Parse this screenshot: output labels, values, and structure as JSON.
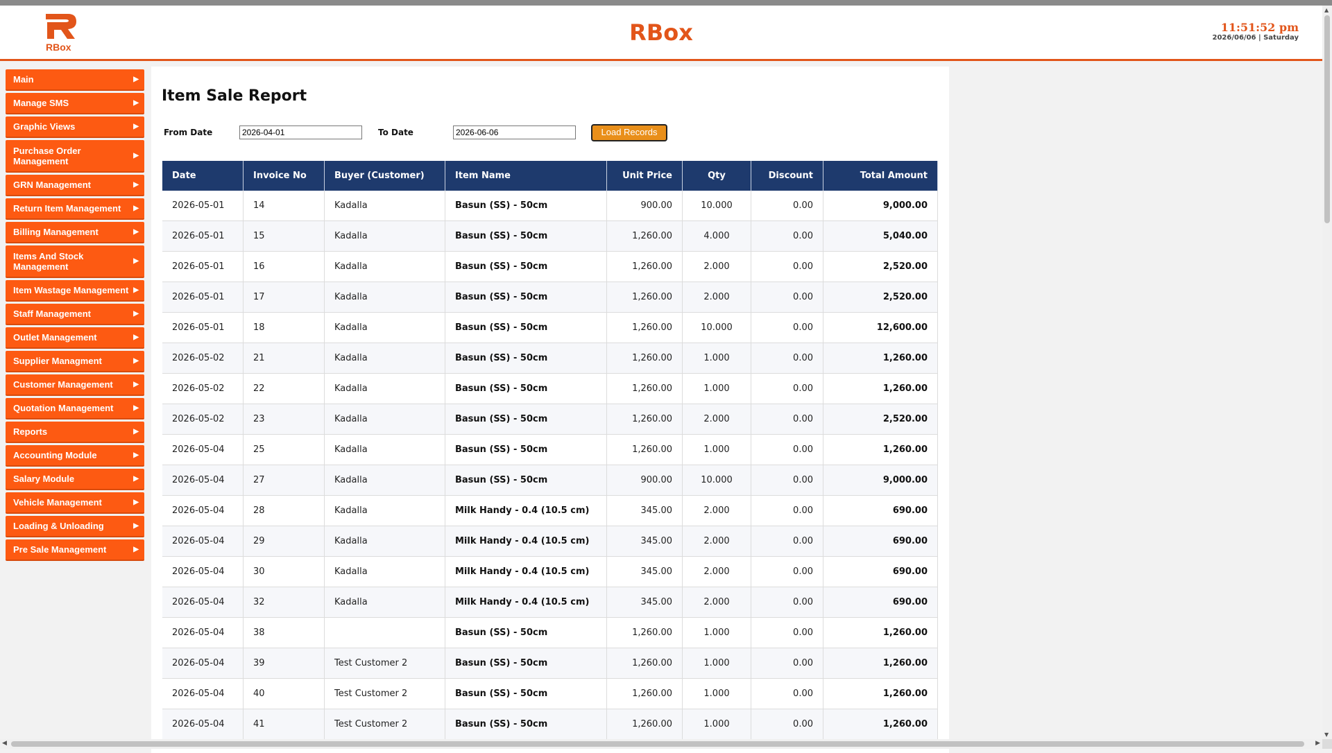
{
  "app": {
    "logo_text": "RBox",
    "title": "RBox",
    "time": "11:51:52 pm",
    "date_line": "2026/06/06 | Saturday",
    "accent_color": "#e2551a",
    "menu_color": "#fd5a12",
    "table_header_color": "#1e3a6d",
    "button_color": "#e98f1a"
  },
  "sidebar": {
    "items": [
      {
        "label": "Main"
      },
      {
        "label": "Manage SMS"
      },
      {
        "label": "Graphic Views"
      },
      {
        "label": "Purchase Order Management"
      },
      {
        "label": "GRN Management"
      },
      {
        "label": "Return Item Management"
      },
      {
        "label": "Billing Management"
      },
      {
        "label": "Items And Stock Management"
      },
      {
        "label": "Item Wastage Management"
      },
      {
        "label": "Staff Management"
      },
      {
        "label": "Outlet Management"
      },
      {
        "label": "Supplier Managment"
      },
      {
        "label": "Customer Management"
      },
      {
        "label": "Quotation Management"
      },
      {
        "label": "Reports"
      },
      {
        "label": "Accounting Module"
      },
      {
        "label": "Salary Module"
      },
      {
        "label": "Vehicle Management"
      },
      {
        "label": "Loading & Unloading"
      },
      {
        "label": "Pre Sale Management"
      }
    ],
    "arrow_icon": "caret-right-icon"
  },
  "page": {
    "title": "Item Sale Report",
    "from_label": "From Date",
    "from_value": "2026-04-01",
    "to_label": "To Date",
    "to_value": "2026-06-06",
    "load_button": "Load Records"
  },
  "table": {
    "headers": {
      "date": "Date",
      "invoice": "Invoice No",
      "buyer": "Buyer (Customer)",
      "item": "Item Name",
      "unit_price": "Unit Price",
      "qty": "Qty",
      "discount": "Discount",
      "total": "Total Amount"
    },
    "rows": [
      {
        "date": "2026-05-01",
        "invoice": "14",
        "buyer": "Kadalla",
        "item": "Basun (SS) - 50cm",
        "unit_price": "900.00",
        "qty": "10.000",
        "discount": "0.00",
        "total": "9,000.00"
      },
      {
        "date": "2026-05-01",
        "invoice": "15",
        "buyer": "Kadalla",
        "item": "Basun (SS) - 50cm",
        "unit_price": "1,260.00",
        "qty": "4.000",
        "discount": "0.00",
        "total": "5,040.00"
      },
      {
        "date": "2026-05-01",
        "invoice": "16",
        "buyer": "Kadalla",
        "item": "Basun (SS) - 50cm",
        "unit_price": "1,260.00",
        "qty": "2.000",
        "discount": "0.00",
        "total": "2,520.00"
      },
      {
        "date": "2026-05-01",
        "invoice": "17",
        "buyer": "Kadalla",
        "item": "Basun (SS) - 50cm",
        "unit_price": "1,260.00",
        "qty": "2.000",
        "discount": "0.00",
        "total": "2,520.00"
      },
      {
        "date": "2026-05-01",
        "invoice": "18",
        "buyer": "Kadalla",
        "item": "Basun (SS) - 50cm",
        "unit_price": "1,260.00",
        "qty": "10.000",
        "discount": "0.00",
        "total": "12,600.00"
      },
      {
        "date": "2026-05-02",
        "invoice": "21",
        "buyer": "Kadalla",
        "item": "Basun (SS) - 50cm",
        "unit_price": "1,260.00",
        "qty": "1.000",
        "discount": "0.00",
        "total": "1,260.00"
      },
      {
        "date": "2026-05-02",
        "invoice": "22",
        "buyer": "Kadalla",
        "item": "Basun (SS) - 50cm",
        "unit_price": "1,260.00",
        "qty": "1.000",
        "discount": "0.00",
        "total": "1,260.00"
      },
      {
        "date": "2026-05-02",
        "invoice": "23",
        "buyer": "Kadalla",
        "item": "Basun (SS) - 50cm",
        "unit_price": "1,260.00",
        "qty": "2.000",
        "discount": "0.00",
        "total": "2,520.00"
      },
      {
        "date": "2026-05-04",
        "invoice": "25",
        "buyer": "Kadalla",
        "item": "Basun (SS) - 50cm",
        "unit_price": "1,260.00",
        "qty": "1.000",
        "discount": "0.00",
        "total": "1,260.00"
      },
      {
        "date": "2026-05-04",
        "invoice": "27",
        "buyer": "Kadalla",
        "item": "Basun (SS) - 50cm",
        "unit_price": "900.00",
        "qty": "10.000",
        "discount": "0.00",
        "total": "9,000.00"
      },
      {
        "date": "2026-05-04",
        "invoice": "28",
        "buyer": "Kadalla",
        "item": "Milk Handy - 0.4 (10.5 cm)",
        "unit_price": "345.00",
        "qty": "2.000",
        "discount": "0.00",
        "total": "690.00"
      },
      {
        "date": "2026-05-04",
        "invoice": "29",
        "buyer": "Kadalla",
        "item": "Milk Handy - 0.4 (10.5 cm)",
        "unit_price": "345.00",
        "qty": "2.000",
        "discount": "0.00",
        "total": "690.00"
      },
      {
        "date": "2026-05-04",
        "invoice": "30",
        "buyer": "Kadalla",
        "item": "Milk Handy - 0.4 (10.5 cm)",
        "unit_price": "345.00",
        "qty": "2.000",
        "discount": "0.00",
        "total": "690.00"
      },
      {
        "date": "2026-05-04",
        "invoice": "32",
        "buyer": "Kadalla",
        "item": "Milk Handy - 0.4 (10.5 cm)",
        "unit_price": "345.00",
        "qty": "2.000",
        "discount": "0.00",
        "total": "690.00"
      },
      {
        "date": "2026-05-04",
        "invoice": "38",
        "buyer": "",
        "item": "Basun (SS) - 50cm",
        "unit_price": "1,260.00",
        "qty": "1.000",
        "discount": "0.00",
        "total": "1,260.00"
      },
      {
        "date": "2026-05-04",
        "invoice": "39",
        "buyer": "Test Customer 2",
        "item": "Basun (SS) - 50cm",
        "unit_price": "1,260.00",
        "qty": "1.000",
        "discount": "0.00",
        "total": "1,260.00"
      },
      {
        "date": "2026-05-04",
        "invoice": "40",
        "buyer": "Test Customer 2",
        "item": "Basun (SS) - 50cm",
        "unit_price": "1,260.00",
        "qty": "1.000",
        "discount": "0.00",
        "total": "1,260.00"
      },
      {
        "date": "2026-05-04",
        "invoice": "41",
        "buyer": "Test Customer 2",
        "item": "Basun (SS) - 50cm",
        "unit_price": "1,260.00",
        "qty": "1.000",
        "discount": "0.00",
        "total": "1,260.00"
      }
    ]
  }
}
